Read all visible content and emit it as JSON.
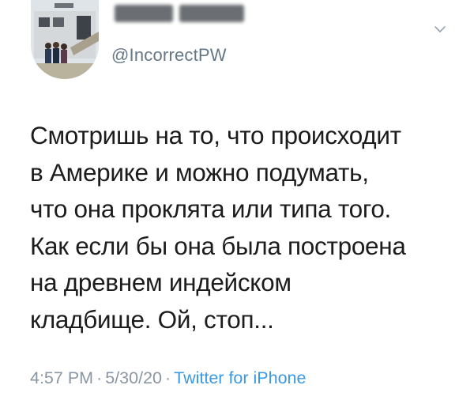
{
  "tweet": {
    "display_name_redacted": "",
    "username": "@IncorrectPW",
    "text_lines": [
      "Смотришь на то, что происходит",
      "в Америке и можно подумать,",
      "что она проклята или типа того.",
      "Как если бы она была построена",
      "на древнем индейском",
      "кладбище. Ой, стоп..."
    ],
    "time": "4:57 PM",
    "date": "5/30/20",
    "source": "Twitter for iPhone",
    "separator": "·"
  },
  "icons": {
    "menu": "chevron-down-icon",
    "avatar": "profile-photo"
  },
  "colors": {
    "meta": "#8a96a1",
    "link": "#3a99e4",
    "text": "#1c1c1c",
    "username": "#657786"
  }
}
